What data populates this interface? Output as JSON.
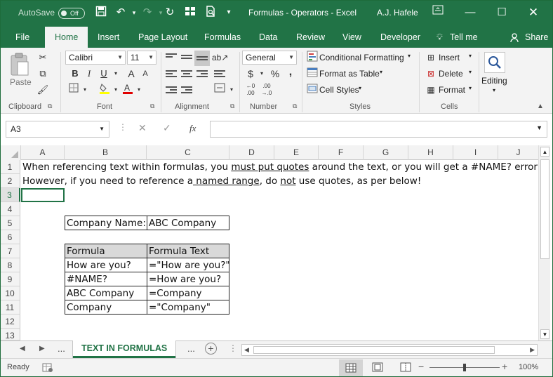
{
  "title_bar": {
    "autosave_label": "AutoSave",
    "autosave_state": "Off",
    "document_title": "Formulas - Operators  -  Excel",
    "user": "A.J. Hafele"
  },
  "tabs": [
    "File",
    "Home",
    "Insert",
    "Page Layout",
    "Formulas",
    "Data",
    "Review",
    "View",
    "Developer",
    "Tell me",
    "Share"
  ],
  "active_tab": "Home",
  "ribbon": {
    "clipboard": {
      "paste_label": "Paste",
      "group": "Clipboard"
    },
    "font": {
      "name": "Calibri",
      "size": "11",
      "bold": "B",
      "italic": "I",
      "underline": "U",
      "group": "Font"
    },
    "alignment": {
      "group": "Alignment"
    },
    "number": {
      "format": "General",
      "currency": "$",
      "percent": "%",
      "comma": ",",
      "group": "Number"
    },
    "styles": {
      "conditional": "Conditional Formatting",
      "table": "Format as Table",
      "cell_styles": "Cell Styles",
      "group": "Styles"
    },
    "cells": {
      "insert": "Insert",
      "delete": "Delete",
      "format": "Format",
      "group": "Cells"
    },
    "editing": {
      "label": "Editing"
    }
  },
  "formula_bar": {
    "name_box": "A3",
    "fx": "fx",
    "formula": ""
  },
  "columns": [
    "A",
    "B",
    "C",
    "D",
    "E",
    "F",
    "G",
    "H",
    "I",
    "J"
  ],
  "rows": [
    "1",
    "2",
    "3",
    "4",
    "5",
    "6",
    "7",
    "8",
    "9",
    "10",
    "11",
    "12",
    "13"
  ],
  "cells": {
    "row1": {
      "p1": "When referencing text within formulas, you ",
      "u1": "must put quotes",
      "p2": " around the text, or you will get a #NAME? error"
    },
    "row2": {
      "p1": "However, if you need to reference a",
      "u1": " named range",
      "p2": ", do ",
      "u2": "not",
      "p3": " use quotes, as per below!"
    },
    "b5": "Company Name:",
    "c5": "ABC Company",
    "b7": "Formula",
    "c7": "Formula Text",
    "b8": "How are you?",
    "c8": "=\"How are you?\"",
    "b9": "#NAME?",
    "c9": "=How are you?",
    "b10": "ABC Company",
    "c10": "=Company",
    "b11": "Company",
    "c11": "=\"Company\""
  },
  "sheet_tabs": {
    "active": "TEXT IN FORMULAS",
    "ellipsis": "..."
  },
  "status_bar": {
    "state": "Ready",
    "zoom": "100%"
  }
}
